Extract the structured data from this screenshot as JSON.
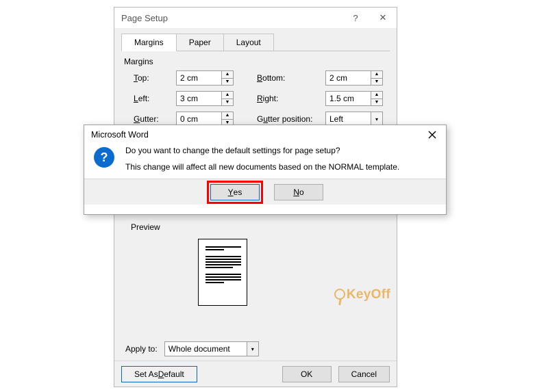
{
  "pagesetup": {
    "title": "Page Setup",
    "help_icon": "?",
    "close_icon": "✕",
    "tabs": {
      "margins": "Margins",
      "paper": "Paper",
      "layout": "Layout"
    },
    "margins_group": "Margins",
    "labels": {
      "top": "Top:",
      "bottom": "Bottom:",
      "left": "Left:",
      "right": "Right:",
      "gutter": "Gutter:",
      "gutter_pos": "Gutter position:",
      "top_key": "T",
      "bottom_key": "B",
      "left_key": "L",
      "right_key": "R",
      "gutter_key": "G",
      "gutter_pos_key": "u"
    },
    "values": {
      "top": "2 cm",
      "bottom": "2 cm",
      "left": "3 cm",
      "right": "1.5 cm",
      "gutter": "0 cm",
      "gutter_pos": "Left"
    },
    "preview_label": "Preview",
    "apply_to_label": "Apply to:",
    "apply_to_value": "Whole document",
    "buttons": {
      "set_default": "Set As Default",
      "set_default_key": "D",
      "ok": "OK",
      "cancel": "Cancel"
    }
  },
  "modal": {
    "title": "Microsoft Word",
    "close_icon": "✕",
    "qmark": "?",
    "line1": "Do you want to change the default settings for page setup?",
    "line2": "This change will affect all new documents based on the NORMAL template.",
    "yes": "Yes",
    "no": "No",
    "yes_key": "Y",
    "no_key": "N"
  },
  "watermark": "KeyOff"
}
